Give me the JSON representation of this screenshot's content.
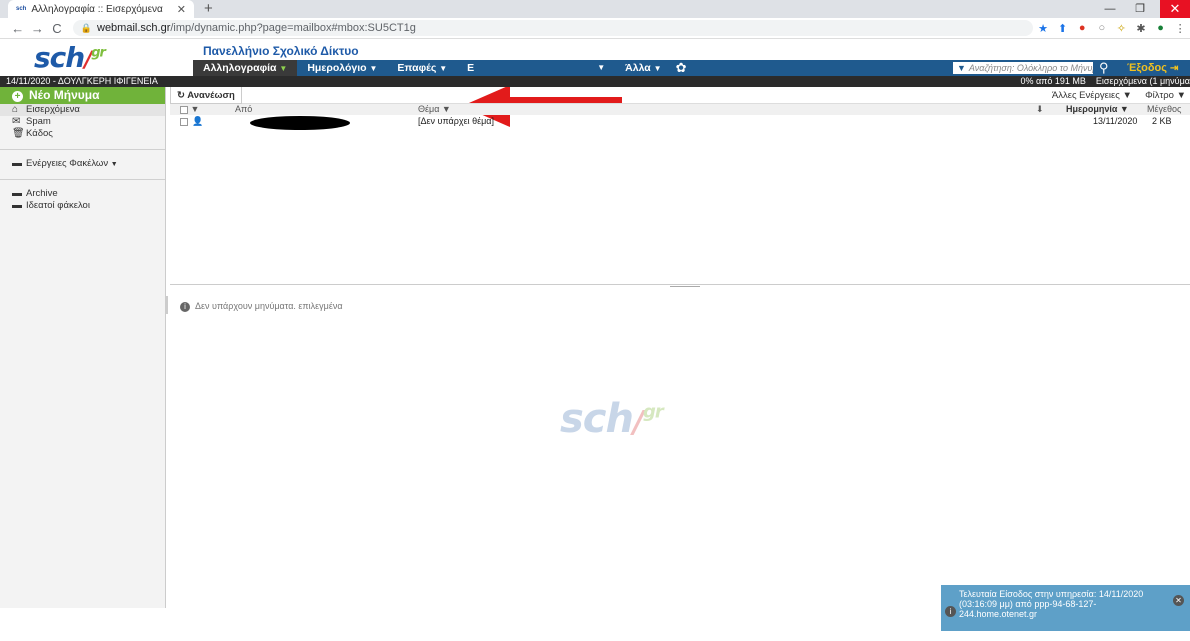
{
  "browser": {
    "tab_title": "Αλληλογραφία :: Εισερχόμενα",
    "url_host": "webmail.sch.gr",
    "url_path": "/imp/dynamic.php?page=mailbox#mbox:SU5CT1g"
  },
  "site": {
    "logo": "sch",
    "logo_suffix": "gr",
    "name": "Πανελλήνιο Σχολικό Δίκτυο"
  },
  "menu": {
    "mail": "Αλληλογραφία",
    "calendar": "Ημερολόγιο",
    "contacts": "Επαφές",
    "partial": "Ε",
    "more": "Άλλα",
    "search_placeholder": "Αναζήτηση: Ολόκληρο το Μήνυμ...",
    "logout": "Έξοδος"
  },
  "infobar": {
    "date_user": "14/11/2020 - ΔΟΥΛΓΚΕΡΗ ΙΦΙΓΕΝΕΙΑ",
    "quota": "0% από 191 MB",
    "folder_status": "Εισερχόμενα (1 μηνύμα"
  },
  "sidebar": {
    "new_message": "Νέο Μήνυμα",
    "inbox": "Εισερχόμενα",
    "spam": "Spam",
    "trash": "Κάδος",
    "folder_actions": "Ενέργειες Φακέλων",
    "archive": "Archive",
    "virtual": "Ιδεατοί φάκελοι"
  },
  "toolbar": {
    "refresh": "Ανανέωση",
    "other_actions": "Άλλες Ενέργειες",
    "filter": "Φίλτρο"
  },
  "columns": {
    "from": "Από",
    "subject": "Θέμα",
    "date": "Ημερομηνία",
    "size": "Μέγεθος"
  },
  "messages": [
    {
      "subject": "[Δεν υπάρχει θέμα]",
      "date": "13/11/2020",
      "size": "2 KB"
    }
  ],
  "preview": {
    "no_selection": "Δεν υπάρχουν μηνύματα. επιλεγμένα"
  },
  "notice": {
    "text": "Τελευταία Είσοδος στην υπηρεσία: 14/11/2020 (03:16:09 μμ) από ppp-94-68-127-244.home.otenet.gr"
  },
  "colors": {
    "menubar": "#1f5a8e",
    "accent_green": "#70b33a",
    "arrow": "#e21b1b"
  }
}
